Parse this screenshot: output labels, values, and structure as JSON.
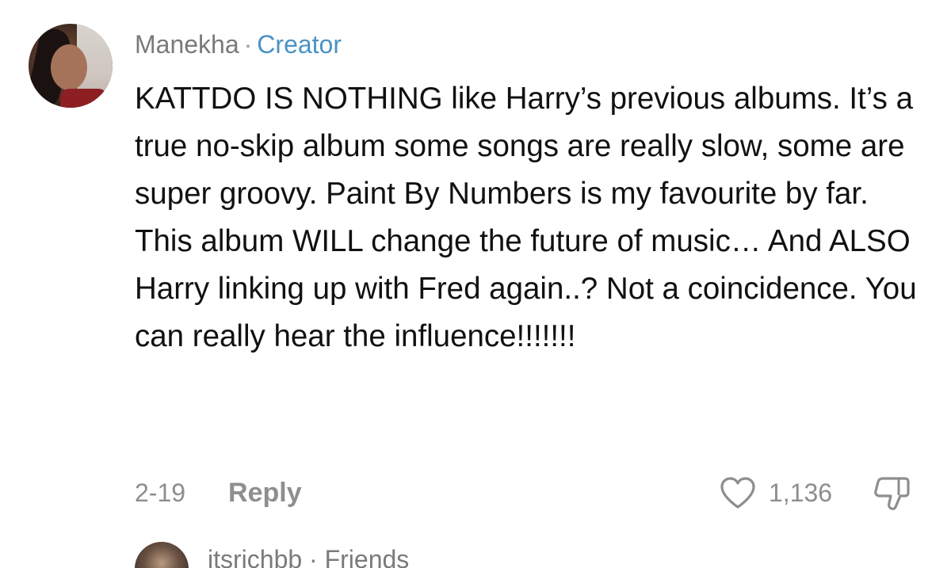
{
  "comment": {
    "username": "Manekha",
    "separator": "·",
    "badge": "Creator",
    "text": "KATTDO IS NOTHING like Harry’s previous albums. It’s a true no-skip album some songs are really slow, some are super groovy. Paint By Numbers is my favourite by far. This album WILL change the future of music… And ALSO Harry linking up with Fred again..? Not a coincidence. You can really hear the influence!!!!!!!",
    "date": "2-19",
    "reply_label": "Reply",
    "like_count": "1,136",
    "like_icon": "heart-outline-icon",
    "dislike_icon": "thumbs-down-icon"
  },
  "next_comment": {
    "username": "itsrichbb",
    "separator": "·",
    "badge": "Friends"
  },
  "colors": {
    "creator_badge": "#4a93c4",
    "muted_text": "#8e8e8e",
    "body_text": "#111111"
  }
}
